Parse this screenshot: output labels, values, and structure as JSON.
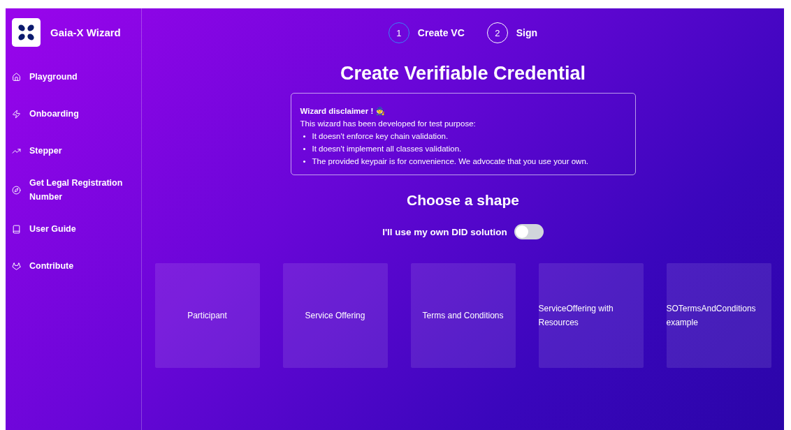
{
  "sidebar": {
    "title": "Gaia-X Wizard",
    "items": [
      {
        "label": "Playground"
      },
      {
        "label": "Onboarding"
      },
      {
        "label": "Stepper"
      },
      {
        "label": "Get Legal Registration Number"
      },
      {
        "label": "User Guide"
      },
      {
        "label": "Contribute"
      }
    ]
  },
  "stepper": [
    {
      "number": "1",
      "label": "Create VC",
      "selected": true
    },
    {
      "number": "2",
      "label": "Sign",
      "selected": false
    }
  ],
  "heading": "Create Verifiable Credential",
  "disclaimer": {
    "title": "Wizard disclaimer ! 🧙",
    "intro": "This wizard has been developed for test purpose:",
    "points": [
      {
        "bullet": "•",
        "text": "It doesn't enforce key chain validation."
      },
      {
        "bullet": "•",
        "text": "It doesn't implement all classes validation."
      },
      {
        "bullet": "•",
        "text": "The provided keypair is for convenience. We advocate that you use your own."
      }
    ]
  },
  "shape_heading": "Choose a shape",
  "did_toggle": {
    "label": "I'll use my own DID solution",
    "on": false
  },
  "shapes": [
    {
      "label": "Participant"
    },
    {
      "label": "Service Offering"
    },
    {
      "label": "Terms and Conditions"
    },
    {
      "label": "ServiceOffering with Resources"
    },
    {
      "label": "SOTermsAndConditions example"
    }
  ]
}
